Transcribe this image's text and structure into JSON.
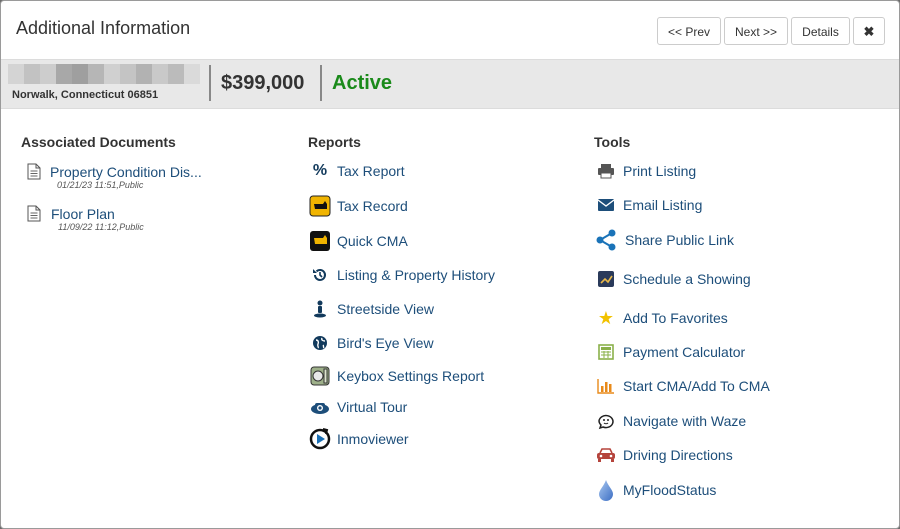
{
  "header": {
    "title": "Additional Information",
    "prev_label": "<< Prev",
    "next_label": "Next >>",
    "details_label": "Details",
    "close_icon": "close-icon"
  },
  "listing": {
    "address": "Norwalk, Connecticut 06851",
    "price": "$399,000",
    "status": "Active",
    "status_color": "#1a8a1a"
  },
  "documents": {
    "heading": "Associated Documents",
    "items": [
      {
        "label": "Property Condition Dis...",
        "meta": "01/21/23 11:51,Public"
      },
      {
        "label": "Floor Plan",
        "meta": "11/09/22 11:12,Public"
      }
    ]
  },
  "reports": {
    "heading": "Reports",
    "items": [
      {
        "label": "Tax Report",
        "icon": "percent-icon"
      },
      {
        "label": "Tax Record",
        "icon": "tax-record-map-icon"
      },
      {
        "label": "Quick CMA",
        "icon": "quick-cma-map-icon"
      },
      {
        "label": "Listing & Property History",
        "icon": "history-icon"
      },
      {
        "label": "Streetside View",
        "icon": "streetside-person-icon"
      },
      {
        "label": "Bird's Eye View",
        "icon": "globe-icon"
      },
      {
        "label": "Keybox Settings Report",
        "icon": "keybox-icon"
      },
      {
        "label": "Virtual Tour",
        "icon": "camera-icon"
      },
      {
        "label": "Inmoviewer",
        "icon": "inmoviewer-play-icon"
      }
    ]
  },
  "tools": {
    "heading": "Tools",
    "items": [
      {
        "label": "Print Listing",
        "icon": "printer-icon"
      },
      {
        "label": "Email Listing",
        "icon": "envelope-icon"
      },
      {
        "label": "Share Public Link",
        "icon": "share-icon"
      },
      {
        "label": "Schedule a Showing",
        "icon": "schedule-showing-icon"
      },
      {
        "label": "Add To Favorites",
        "icon": "star-icon"
      },
      {
        "label": "Payment Calculator",
        "icon": "calculator-icon"
      },
      {
        "label": "Start CMA/Add To CMA",
        "icon": "bar-chart-icon"
      },
      {
        "label": "Navigate with Waze",
        "icon": "waze-icon"
      },
      {
        "label": "Driving Directions",
        "icon": "car-icon"
      },
      {
        "label": "MyFloodStatus",
        "icon": "water-drop-icon"
      }
    ]
  }
}
